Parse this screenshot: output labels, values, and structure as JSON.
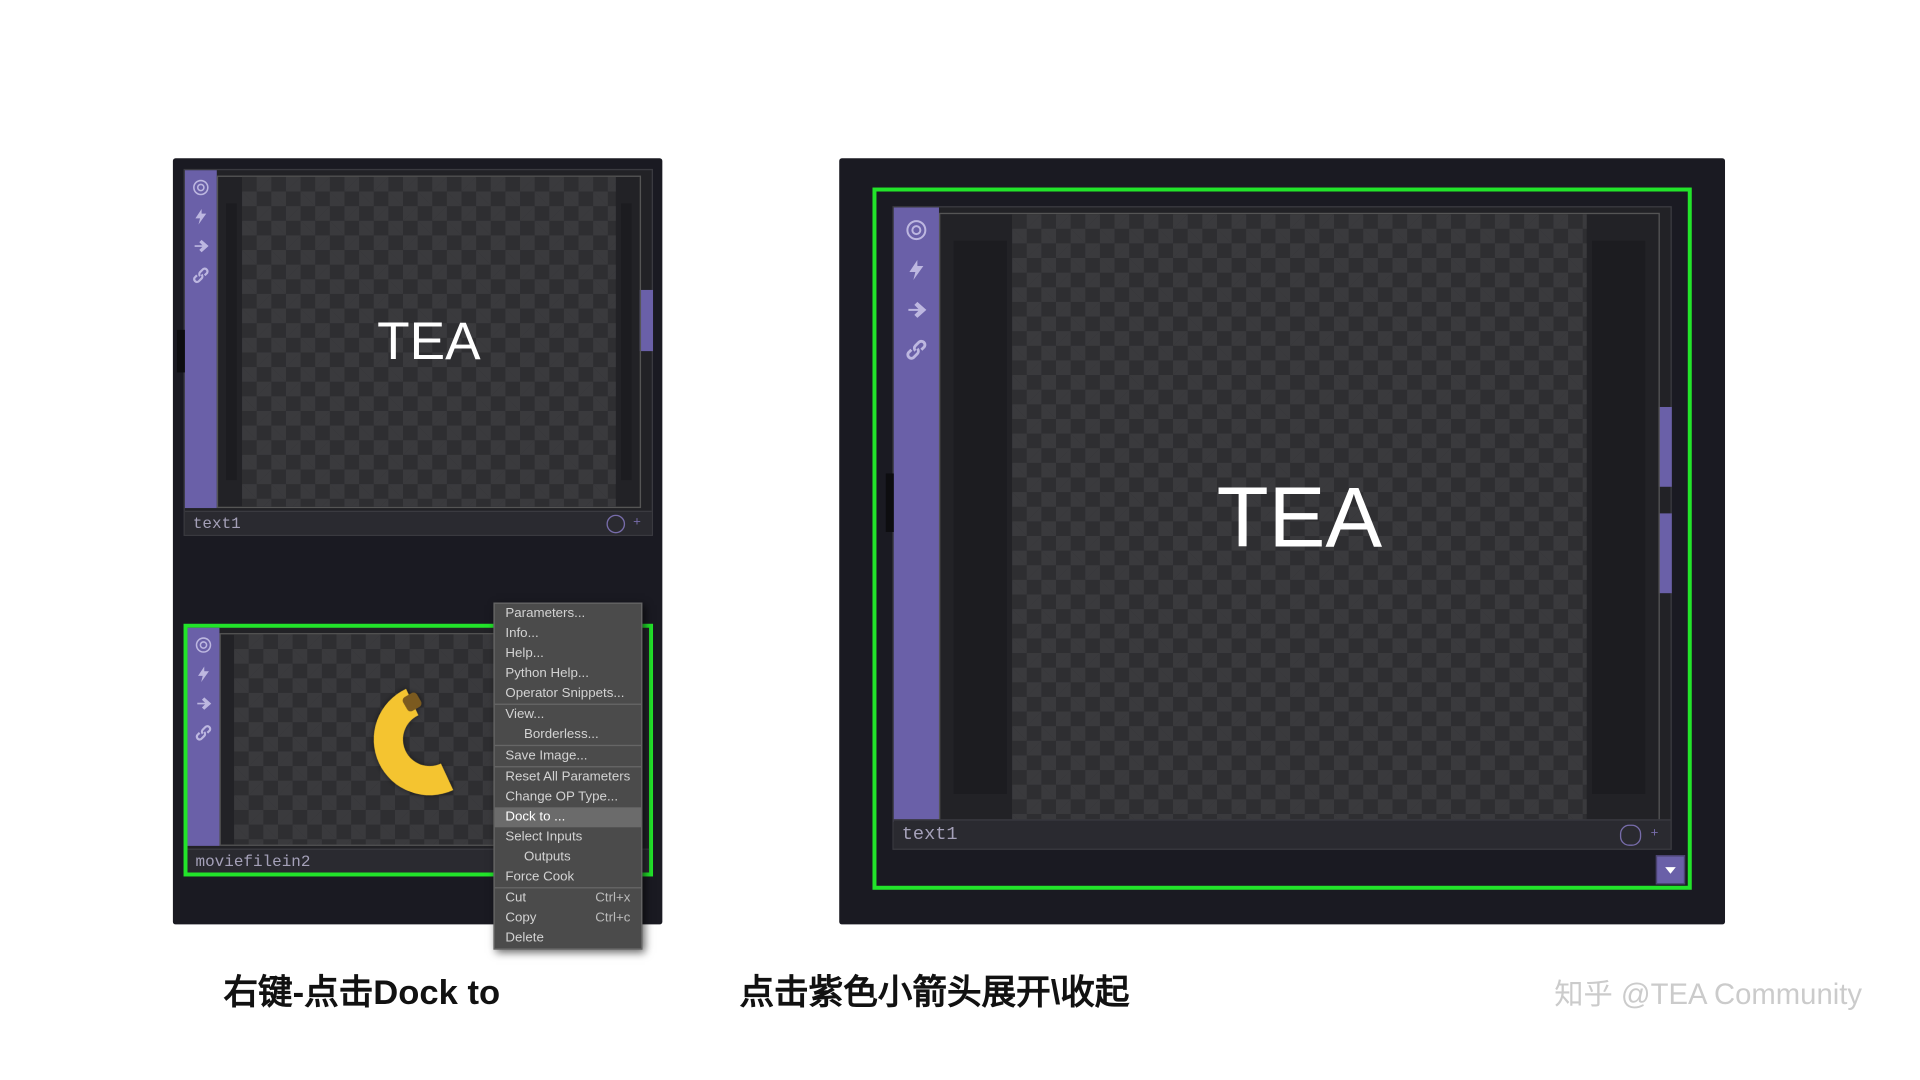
{
  "colors": {
    "accent": "#6a60a8",
    "highlight": "#22e42a"
  },
  "left_panel": {
    "viewer_top": {
      "node_name": "text1",
      "canvas_text": "TEA",
      "toolbar_icons": [
        "eye-icon",
        "bolt-icon",
        "arrow-right-icon",
        "link-icon"
      ]
    },
    "viewer_bottom": {
      "node_name": "moviefilein2",
      "toolbar_icons": [
        "eye-icon",
        "bolt-icon",
        "arrow-right-icon",
        "link-icon"
      ]
    }
  },
  "right_panel": {
    "viewer": {
      "node_name": "text1",
      "canvas_text": "TEA",
      "toolbar_icons": [
        "eye-icon",
        "bolt-icon",
        "arrow-right-icon",
        "link-icon"
      ]
    }
  },
  "context_menu": {
    "items": [
      {
        "label": "Parameters...",
        "indent": false
      },
      {
        "label": "Info...",
        "indent": false
      },
      {
        "label": "Help...",
        "indent": false
      },
      {
        "label": "Python Help...",
        "indent": false
      },
      {
        "label": "Operator Snippets...",
        "indent": false
      },
      {
        "label": "View...",
        "indent": false,
        "sep_before": true
      },
      {
        "label": "Borderless...",
        "indent": true
      },
      {
        "label": "Save Image...",
        "indent": false,
        "sep_before": true
      },
      {
        "label": "Reset All Parameters",
        "indent": false,
        "sep_before": true
      },
      {
        "label": "Change OP Type...",
        "indent": false
      },
      {
        "label": "Dock to ...",
        "indent": false,
        "highlight": true
      },
      {
        "label": "Select Inputs",
        "indent": false
      },
      {
        "label": "Outputs",
        "indent": true
      },
      {
        "label": "Force Cook",
        "indent": false
      },
      {
        "label": "Cut",
        "indent": false,
        "shortcut": "Ctrl+x",
        "sep_before": true
      },
      {
        "label": "Copy",
        "indent": false,
        "shortcut": "Ctrl+c"
      },
      {
        "label": "Delete",
        "indent": false
      }
    ]
  },
  "captions": {
    "left": "右键-点击Dock to",
    "right": "点击紫色小箭头展开\\收起"
  },
  "watermark": "知乎 @TEA Community"
}
